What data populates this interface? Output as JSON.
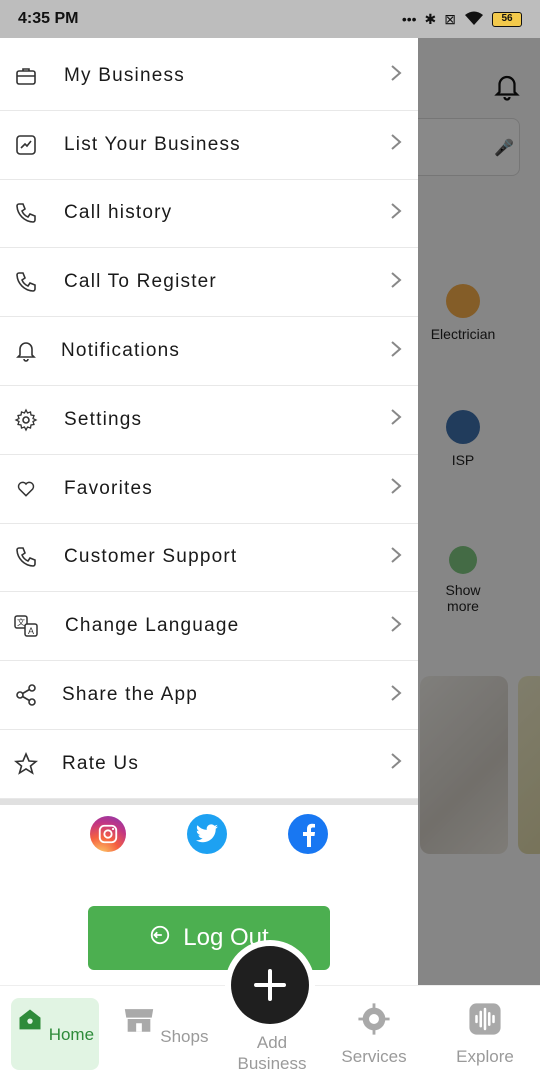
{
  "status_bar": {
    "time": "4:35 PM",
    "battery": "56"
  },
  "background": {
    "categories": [
      {
        "label": "Electrician"
      },
      {
        "label": "ISP"
      },
      {
        "label": "Show more"
      }
    ]
  },
  "drawer": {
    "items": [
      {
        "label": "My Business",
        "icon": "briefcase-icon"
      },
      {
        "label": "List Your Business",
        "icon": "chart-icon"
      },
      {
        "label": "Call history",
        "icon": "phone-icon"
      },
      {
        "label": "Call To Register",
        "icon": "phone-icon"
      },
      {
        "label": "Notifications",
        "icon": "bell-icon"
      },
      {
        "label": "Settings",
        "icon": "gear-icon"
      },
      {
        "label": "Favorites",
        "icon": "heart-icon"
      },
      {
        "label": "Customer Support",
        "icon": "phone-icon"
      },
      {
        "label": "Change Language",
        "icon": "translate-icon"
      },
      {
        "label": "Share the App",
        "icon": "share-icon"
      },
      {
        "label": "Rate Us",
        "icon": "star-icon"
      }
    ],
    "social": [
      "instagram-icon",
      "twitter-icon",
      "facebook-icon"
    ],
    "logout_label": "Log Out"
  },
  "bottom_nav": {
    "items": [
      {
        "label": "Home"
      },
      {
        "label": "Shops"
      },
      {
        "label": "Add Business"
      },
      {
        "label": "Services"
      },
      {
        "label": "Explore"
      }
    ]
  },
  "colors": {
    "accent": "#4caf50",
    "home_bg": "#e1f4e3",
    "fab": "#1f1f1f"
  }
}
